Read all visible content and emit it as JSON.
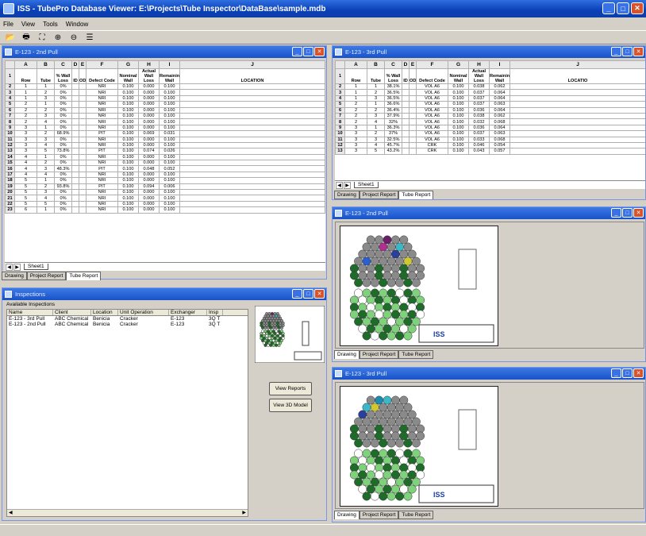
{
  "app": {
    "title": "ISS - TubePro Database Viewer: E:\\Projects\\Tube Inspector\\DataBase\\sample.mdb"
  },
  "menu": [
    "File",
    "View",
    "Tools",
    "Window"
  ],
  "toolbar_icons": [
    "open-icon",
    "print-icon",
    "zoom-fit-icon",
    "zoom-in-icon",
    "zoom-out-icon",
    "list-icon"
  ],
  "win_2nd_table": {
    "title": "E-123 - 2nd Pull",
    "col_letters": [
      "A",
      "B",
      "C",
      "D",
      "E",
      "F",
      "G",
      "H",
      "I",
      "J"
    ],
    "headers": [
      "Row",
      "Tube",
      "% Wall Loss",
      "ID",
      "OD",
      "Defect Code",
      "Nominal Wall",
      "Actual Wall Loss",
      "Remaining Wall",
      "LOCATION"
    ],
    "rows": [
      [
        "1",
        "1",
        "0%",
        "",
        "",
        "NRI",
        "0.100",
        "0.000",
        "0.100"
      ],
      [
        "1",
        "2",
        "0%",
        "",
        "",
        "NRI",
        "0.100",
        "0.000",
        "0.100"
      ],
      [
        "1",
        "3",
        "0%",
        "",
        "",
        "NRI",
        "0.100",
        "0.000",
        "0.100"
      ],
      [
        "2",
        "1",
        "0%",
        "",
        "",
        "NRI",
        "0.100",
        "0.000",
        "0.100"
      ],
      [
        "2",
        "2",
        "0%",
        "",
        "",
        "NRI",
        "0.100",
        "0.000",
        "0.100"
      ],
      [
        "2",
        "3",
        "0%",
        "",
        "",
        "NRI",
        "0.100",
        "0.000",
        "0.100"
      ],
      [
        "2",
        "4",
        "0%",
        "",
        "",
        "NRI",
        "0.100",
        "0.000",
        "0.100"
      ],
      [
        "3",
        "1",
        "0%",
        "",
        "",
        "NRI",
        "0.100",
        "0.000",
        "0.100"
      ],
      [
        "3",
        "2",
        "68.9%",
        "",
        "",
        "PIT",
        "0.100",
        "0.069",
        "0.031"
      ],
      [
        "3",
        "3",
        "0%",
        "",
        "",
        "NRI",
        "0.100",
        "0.000",
        "0.100"
      ],
      [
        "3",
        "4",
        "0%",
        "",
        "",
        "NRI",
        "0.100",
        "0.000",
        "0.100"
      ],
      [
        "3",
        "5",
        "73.8%",
        "",
        "",
        "PIT",
        "0.100",
        "0.074",
        "0.026"
      ],
      [
        "4",
        "1",
        "0%",
        "",
        "",
        "NRI",
        "0.100",
        "0.000",
        "0.100"
      ],
      [
        "4",
        "2",
        "0%",
        "",
        "",
        "NRI",
        "0.100",
        "0.000",
        "0.100"
      ],
      [
        "4",
        "3",
        "48.3%",
        "",
        "",
        "PIT",
        "0.100",
        "0.048",
        "0.052"
      ],
      [
        "4",
        "4",
        "0%",
        "",
        "",
        "NRI",
        "0.100",
        "0.000",
        "0.100"
      ],
      [
        "5",
        "1",
        "0%",
        "",
        "",
        "NRI",
        "0.100",
        "0.000",
        "0.100"
      ],
      [
        "5",
        "2",
        "93.8%",
        "",
        "",
        "PIT",
        "0.100",
        "0.094",
        "0.006"
      ],
      [
        "5",
        "3",
        "0%",
        "",
        "",
        "NRI",
        "0.100",
        "0.000",
        "0.100"
      ],
      [
        "5",
        "4",
        "0%",
        "",
        "",
        "NRI",
        "0.100",
        "0.000",
        "0.100"
      ],
      [
        "5",
        "5",
        "0%",
        "",
        "",
        "NRI",
        "0.100",
        "0.000",
        "0.100"
      ],
      [
        "6",
        "1",
        "0%",
        "",
        "",
        "NRI",
        "0.100",
        "0.000",
        "0.100"
      ]
    ],
    "sheet_tab": "Sheet1",
    "tabs": [
      "Drawing",
      "Project Report",
      "Tube Report"
    ]
  },
  "win_3rd_table": {
    "title": "E-123 - 3rd Pull",
    "col_letters": [
      "A",
      "B",
      "C",
      "D",
      "E",
      "F",
      "G",
      "H",
      "I",
      "J"
    ],
    "headers": [
      "Row",
      "Tube",
      "% Wall Loss",
      "ID",
      "OD",
      "Defect Code",
      "Nominal Wall",
      "Actual Wall Loss",
      "Remaining Wall",
      "LOCATIO"
    ],
    "rows": [
      [
        "1",
        "1",
        "38.1%",
        "",
        "",
        "VOL A6",
        "0.100",
        "0.038",
        "0.062"
      ],
      [
        "1",
        "2",
        "36.5%",
        "",
        "",
        "VOL A6",
        "0.100",
        "0.037",
        "0.064"
      ],
      [
        "1",
        "3",
        "36.5%",
        "",
        "",
        "VOL A6",
        "0.100",
        "0.037",
        "0.064"
      ],
      [
        "2",
        "1",
        "36.6%",
        "",
        "",
        "VOL A6",
        "0.100",
        "0.037",
        "0.063"
      ],
      [
        "2",
        "2",
        "36.4%",
        "",
        "",
        "VOL A6",
        "0.100",
        "0.036",
        "0.064"
      ],
      [
        "2",
        "3",
        "37.9%",
        "",
        "",
        "VOL A6",
        "0.100",
        "0.038",
        "0.062"
      ],
      [
        "2",
        "4",
        "32%",
        "",
        "",
        "VOL A6",
        "0.100",
        "0.032",
        "0.068"
      ],
      [
        "3",
        "1",
        "36.3%",
        "",
        "",
        "VOL A6",
        "0.100",
        "0.036",
        "0.064"
      ],
      [
        "3",
        "2",
        "37%",
        "",
        "",
        "VOL A6",
        "0.100",
        "0.037",
        "0.063"
      ],
      [
        "3",
        "3",
        "32.5%",
        "",
        "",
        "VOL A6",
        "0.100",
        "0.033",
        "0.068"
      ],
      [
        "3",
        "4",
        "45.7%",
        "",
        "",
        "CRK",
        "0.100",
        "0.046",
        "0.054"
      ],
      [
        "3",
        "5",
        "43.2%",
        "",
        "",
        "CRK",
        "0.100",
        "0.043",
        "0.057"
      ]
    ],
    "sheet_tab": "Sheet1",
    "tabs": [
      "Drawing",
      "Project Report",
      "Tube Report"
    ]
  },
  "win_2nd_drawing": {
    "title": "E-123 - 2nd Pull",
    "tabs": [
      "Drawing",
      "Project Report",
      "Tube Report"
    ],
    "logo": "ISS"
  },
  "win_3rd_drawing": {
    "title": "E-123 - 3rd Pull",
    "tabs": [
      "Drawing",
      "Project Report",
      "Tube Report"
    ],
    "logo": "ISS"
  },
  "inspections": {
    "title": "Inspections",
    "group_label": "Available Inspections",
    "columns": [
      "Name",
      "Client",
      "Location",
      "Unit Operation",
      "Exchanger",
      "Insp"
    ],
    "rows": [
      [
        "E-123 - 3rd Pull",
        "ABC Chemical",
        "Benicia",
        "Cracker",
        "E-123",
        "3Q T"
      ],
      [
        "E-123 - 2nd Pull",
        "ABC Chemical",
        "Benicia",
        "Cracker",
        "E-123",
        "3Q T"
      ]
    ],
    "view_reports": "View Reports",
    "view_3d": "View 3D Model"
  },
  "colors": {
    "title_bar": "#1852c8",
    "close": "#d9522b",
    "dark_green": "#1f6b2a",
    "light_green": "#7fd17c",
    "gray": "#8a8a8a"
  }
}
